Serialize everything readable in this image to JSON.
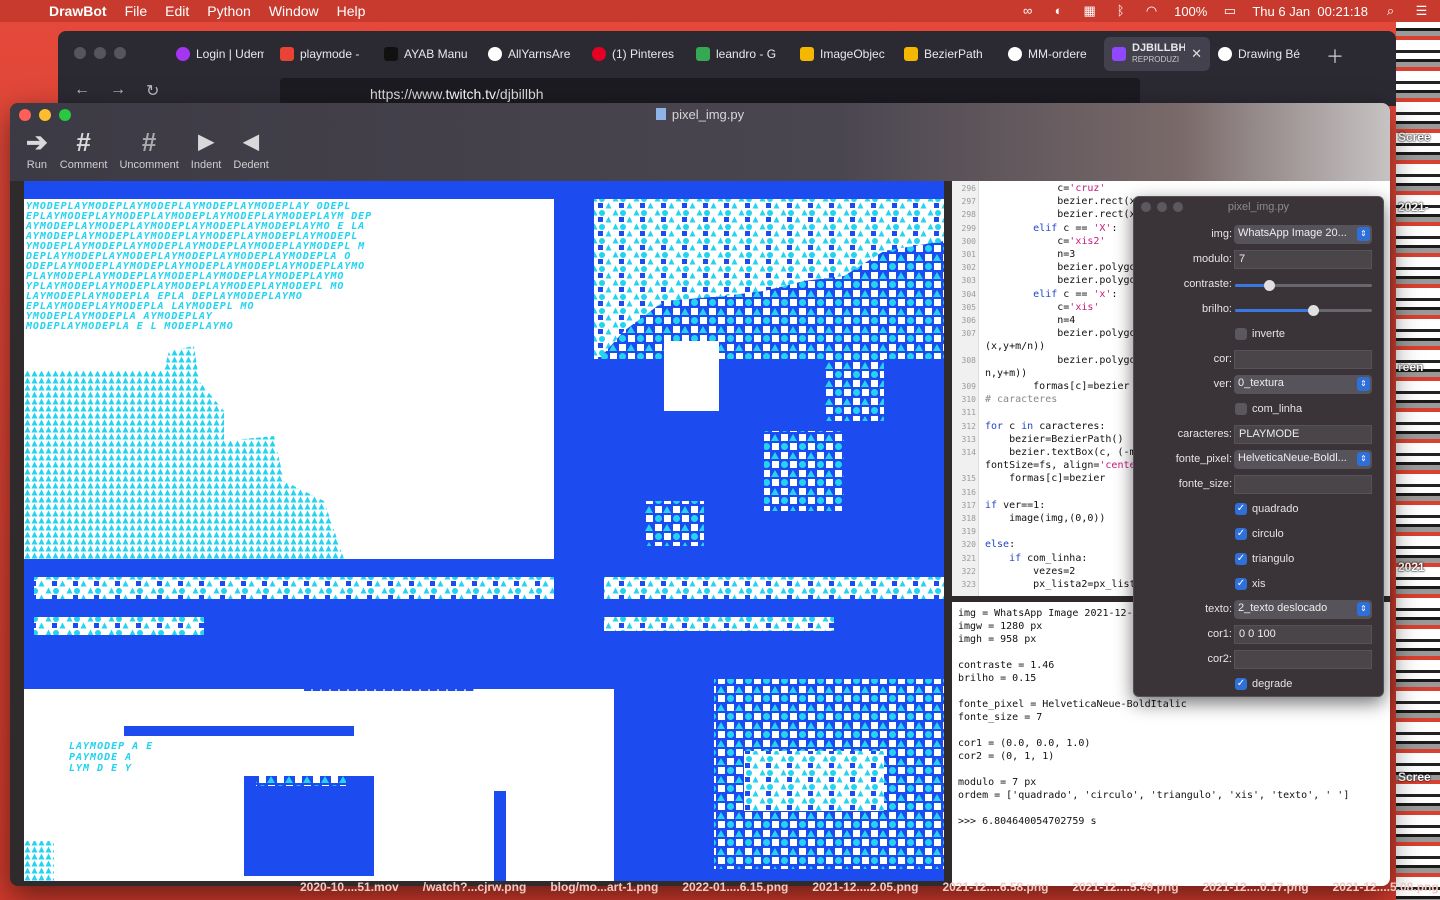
{
  "menubar": {
    "app": "DrawBot",
    "items": [
      "File",
      "Edit",
      "Python",
      "Window",
      "Help"
    ],
    "battery": "100%",
    "datetime": "Thu 6 Jan  00:21:18",
    "status_icons": [
      "creative-cloud-icon",
      "circle-icon",
      "calendar-icon",
      "bluetooth-icon",
      "wifi-icon",
      "battery-icon",
      "search-icon",
      "control-center-icon"
    ]
  },
  "browser": {
    "tabs": [
      {
        "label": "Login | Udem",
        "icon_color": "#a435f0"
      },
      {
        "label": "playmode -",
        "icon_color": "#ea4335"
      },
      {
        "label": "AYAB Manu",
        "icon_color": "#111111"
      },
      {
        "label": "AllYarnsAre",
        "icon_color": "#ffffff"
      },
      {
        "label": "(1) Pinteres",
        "icon_color": "#e60023"
      },
      {
        "label": "leandro - G",
        "icon_color": "#34a853"
      },
      {
        "label": "ImageObjec",
        "icon_color": "#f5b700"
      },
      {
        "label": "BezierPath",
        "icon_color": "#f5b700"
      },
      {
        "label": "MM-ordere",
        "icon_color": "#ffffff"
      },
      {
        "label": "DJBILLBH",
        "sub": "REPRODUZI",
        "icon_color": "#9146ff",
        "active": true
      },
      {
        "label": "Drawing Bé",
        "icon_color": "#ffffff"
      }
    ],
    "url_prefix": "https://www.",
    "url_host": "twitch.tv",
    "url_path": "/djbillbh"
  },
  "window": {
    "title": "pixel_img.py",
    "toolbar": [
      {
        "label": "Run",
        "icon": "run-arrow-icon",
        "glyph": "➔"
      },
      {
        "label": "Comment",
        "icon": "hash-icon",
        "glyph": "#"
      },
      {
        "label": "Uncomment",
        "icon": "uncomment-hash-icon",
        "glyph": "#"
      },
      {
        "label": "Indent",
        "icon": "indent-triangle-icon",
        "glyph": "▶"
      },
      {
        "label": "Dedent",
        "icon": "dedent-triangle-icon",
        "glyph": "◀"
      }
    ]
  },
  "canvas": {
    "fill": "#1c4cf0",
    "glyph_color": "#23d3f0",
    "text": "PLAYMODE",
    "sample_rows": [
      "YMODEPLAYMODEPLAYMODEPLAYMODEPLAYMODEPLAY  ODEPL",
      "EPLAYMODEPLAYMODEPLAYMODEPLAYMODEPLAYMODEPLAYM DEP",
      "AYMODEPLAYMODEPLAYMODEPLAYMODEPLAYMODEPLAYMO  E LA",
      "AYMODEPLAYMODEPLAYMODEPLAYMODEPLAYMODEPLAYMODEPL",
      "YMODEPLAYMODEPLAYMODEPLAYMODEPLAYMODEPLAYMODEPL  M",
      "DEPLAYMODEPLAYMODEPLAYMODEPLAYMODEPLAYMODEPLA   O",
      "ODEPLAYMODEPLAYMODEPLAYMODEPLAYMODEPLAYMODEPLAYMO",
      "PLAYMODEPLAYMODEPLAYMODEPLAYMODEPLAYMODEPLAYMO",
      "YPLAYMODEPLAYMODEPLAYMODEPLAYMODEPLAYMODEPL   MO",
      "LAYMODEPLAYMODEPLA     EPLA    DEPLAYMODEPLAYMO",
      "EPLAYMODEPLAYMODEPLA              LAYMODEPL   MO",
      "YMODEPLAYMODEPLA                   AYMODEPLAY",
      "MODEPLAYMODEPLA    E          L   MODEPLAYMO"
    ],
    "bottom_rows": [
      "LAYMODEP  A          E",
      "PAYMODE              A",
      "LYM  D        E       Y"
    ]
  },
  "code": {
    "lines": [
      {
        "n": "296",
        "t": "            c='cruz'"
      },
      {
        "n": "297",
        "t": "            bezier.rect(x+m/4,"
      },
      {
        "n": "298",
        "t": "            bezier.rect(x,y+m/4"
      },
      {
        "n": "299",
        "t": "        elif c == 'X':"
      },
      {
        "n": "300",
        "t": "            c='xis2'"
      },
      {
        "n": "301",
        "t": "            n=3"
      },
      {
        "n": "302",
        "t": "            bezier.polygon((x,"
      },
      {
        "n": "303",
        "t": "            bezier.polygon((x,"
      },
      {
        "n": "304",
        "t": "        elif c == 'x':"
      },
      {
        "n": "305",
        "t": "            c='xis'"
      },
      {
        "n": "306",
        "t": "            n=4"
      },
      {
        "n": "307",
        "t": "            bezier.polygon((x,"
      },
      {
        "n": "",
        "t": "(x,y+m/n))"
      },
      {
        "n": "308",
        "t": "            bezier.polygon((x,"
      },
      {
        "n": "",
        "t": "n,y+m))"
      },
      {
        "n": "309",
        "t": "        formas[c]=bezier"
      },
      {
        "n": "310",
        "t": "# caracteres"
      },
      {
        "n": "311",
        "t": ""
      },
      {
        "n": "312",
        "t": "for c in caracteres:"
      },
      {
        "n": "313",
        "t": "    bezier=BezierPath()"
      },
      {
        "n": "314",
        "t": "    bezier.textBox(c, (-m"
      },
      {
        "n": "",
        "t": "fontSize=fs, align='center'"
      },
      {
        "n": "315",
        "t": "    formas[c]=bezier"
      },
      {
        "n": "316",
        "t": ""
      },
      {
        "n": "317",
        "t": "if ver==1:"
      },
      {
        "n": "318",
        "t": "    image(img,(0,0))"
      },
      {
        "n": "319",
        "t": ""
      },
      {
        "n": "320",
        "t": "else:"
      },
      {
        "n": "321",
        "t": "    if com_linha:"
      },
      {
        "n": "322",
        "t": "        vezes=2"
      },
      {
        "n": "323",
        "t": "        px_lista2=px_lista"
      }
    ]
  },
  "output": {
    "lines": [
      "img = WhatsApp Image 2021-12-",
      "imgw = 1280 px",
      "imgh = 958 px",
      "",
      "contraste = 1.46",
      "brilho = 0.15",
      "",
      "fonte_pixel = HelveticaNeue-BoldItalic",
      "fonte_size = 7",
      "",
      "cor1 = (0.0, 0.0, 1.0)",
      "cor2 = (0, 1, 1)",
      "",
      "modulo = 7 px",
      "ordem = ['quadrado', 'circulo', 'triangulo', 'xis', 'texto', ' ']",
      "",
      ">>> 6.804640054702759 s"
    ]
  },
  "panel": {
    "title": "pixel_img.py",
    "img_label": "img:",
    "img_value": "WhatsApp Image 20...",
    "modulo_label": "modulo:",
    "modulo_value": "7",
    "contraste_label": "contraste:",
    "contraste_level": 0.25,
    "brilho_label": "brilho:",
    "brilho_level": 0.57,
    "inverte_label": "inverte",
    "inverte_checked": false,
    "cor_label": "cor:",
    "cor_value": "",
    "ver_label": "ver:",
    "ver_value": "0_textura",
    "com_linha_label": "com_linha",
    "com_linha_checked": false,
    "caracteres_label": "caracteres:",
    "caracteres_value": "PLAYMODE",
    "fonte_pixel_label": "fonte_pixel:",
    "fonte_pixel_value": "HelveticaNeue-Boldl...",
    "fonte_size_label": "fonte_size:",
    "fonte_size_value": "",
    "quadrado_label": "quadrado",
    "circulo_label": "circulo",
    "triangulo_label": "triangulo",
    "xis_label": "xis",
    "texto_label": "texto:",
    "texto_value": "2_texto deslocado",
    "cor1_label": "cor1:",
    "cor1_value": "0 0 100",
    "cor2_label": "cor2:",
    "cor2_value": "",
    "degrade_label": "degrade"
  },
  "finder_strip": [
    "2020-10....51.mov",
    "/watch?...cjrw.png",
    "blog/mo...art-1.png",
    "2022-01....6.15.png",
    "2021-12....2.05.png",
    "2021-12....6.58.png",
    "2021-12....5.49.png",
    "2021-12....0.17.png",
    "2021-12....5.08.png",
    "2021"
  ],
  "side_labels": [
    "Scree",
    "2021-",
    "reen",
    "2021",
    "Scree"
  ]
}
